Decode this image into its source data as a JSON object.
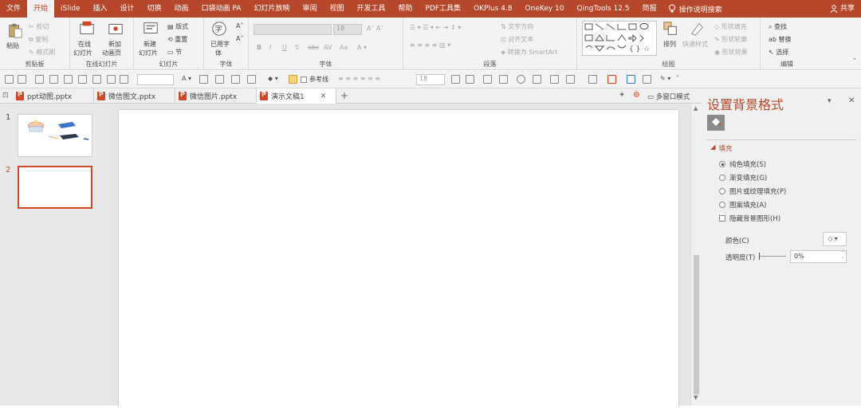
{
  "menu": {
    "items": [
      "文件",
      "开始",
      "iSlide",
      "插入",
      "设计",
      "切换",
      "动画",
      "口袋动画 PA",
      "幻灯片放映",
      "审阅",
      "视图",
      "开发工具",
      "帮助",
      "PDF工具集",
      "OKPlus 4.8",
      "OneKey 10",
      "QingTools 12.5",
      "简报"
    ],
    "search": "操作说明搜索",
    "share": "共享"
  },
  "ribbon": {
    "clipboard": {
      "paste": "粘贴",
      "cut": "剪切",
      "copy": "复制",
      "format_painter": "格式刷",
      "label": "剪贴板"
    },
    "online": {
      "online_slide": "在线",
      "online_slide2": "幻灯片",
      "new_anim": "新加",
      "new_anim2": "动画页",
      "label": "在线幻灯片"
    },
    "slides": {
      "new_slide": "新建",
      "new_slide2": "幻灯片",
      "layout": "版式",
      "reset": "重置",
      "section": "节",
      "label": "幻灯片"
    },
    "fontgrp": {
      "used_font": "已用字",
      "used_font2": "体",
      "label": "字体"
    },
    "font": {
      "size": "18",
      "bold": "B",
      "italic": "I",
      "underline": "U",
      "strike": "S",
      "spacing": "AV",
      "case": "Aa",
      "label": "字体"
    },
    "paragraph": {
      "text_dir": "文字方向",
      "align_text": "对齐文本",
      "smartart": "转换为 SmartArt",
      "label": "段落"
    },
    "drawing": {
      "arrange": "排列",
      "quick_styles": "快速样式",
      "shape_fill": "形状填充",
      "shape_outline": "形状轮廓",
      "shape_effects": "形状效果",
      "label": "绘图"
    },
    "editing": {
      "find": "查找",
      "replace": "替换",
      "select": "选择",
      "label": "编辑"
    }
  },
  "qat": {
    "ref_line": "参考线",
    "size": "18"
  },
  "tabs": [
    {
      "label": "ppt动图.pptx"
    },
    {
      "label": "微信图文.pptx"
    },
    {
      "label": "微信图片.pptx"
    },
    {
      "label": "演示文稿1"
    }
  ],
  "multi_window": "多窗口模式",
  "thumbnails": {
    "n1": "1",
    "n2": "2"
  },
  "pane": {
    "title": "设置背景格式",
    "section": "填充",
    "options": [
      "纯色填充(S)",
      "渐变填充(G)",
      "图片或纹理填充(P)",
      "图案填充(A)"
    ],
    "hide_bg": "隐藏背景图形(H)",
    "color_label": "颜色(C)",
    "transparency_label": "透明度(T)",
    "transparency_value": "0%"
  },
  "colors": {
    "accent": "#b7472a",
    "pane_bg": "#f0f0f0"
  }
}
